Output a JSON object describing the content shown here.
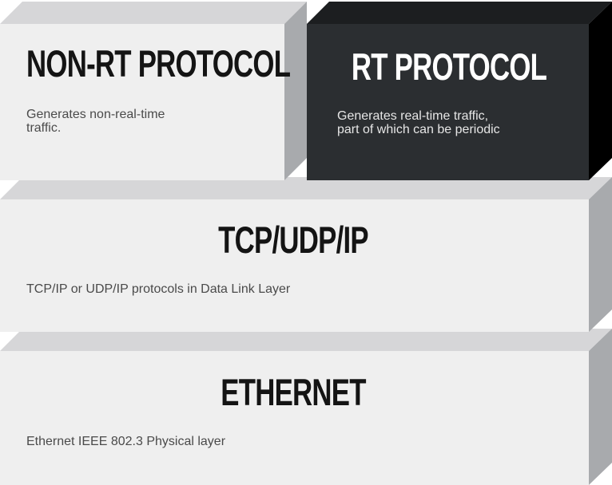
{
  "layers": [
    {
      "id": "non-rt-protocol",
      "title": "NON-RT PROTOCOL",
      "description": "Generates non-real-time\ntraffic."
    },
    {
      "id": "rt-protocol",
      "title": "RT PROTOCOL",
      "description": "Generates real-time traffic,\npart of which can be periodic"
    },
    {
      "id": "tcp-udp-ip",
      "title": "TCP/UDP/IP",
      "description": "TCP/IP or UDP/IP protocols in Data Link Layer"
    },
    {
      "id": "ethernet",
      "title": "ETHERNET",
      "description": "Ethernet IEEE 802.3 Physical layer"
    }
  ],
  "colors": {
    "light_front": "#efefef",
    "light_top": "#d6d6d8",
    "light_side": "#a8aaad",
    "dark_front": "#2b2e31",
    "dark_top": "#1c1e20",
    "dark_side": "#000000"
  }
}
